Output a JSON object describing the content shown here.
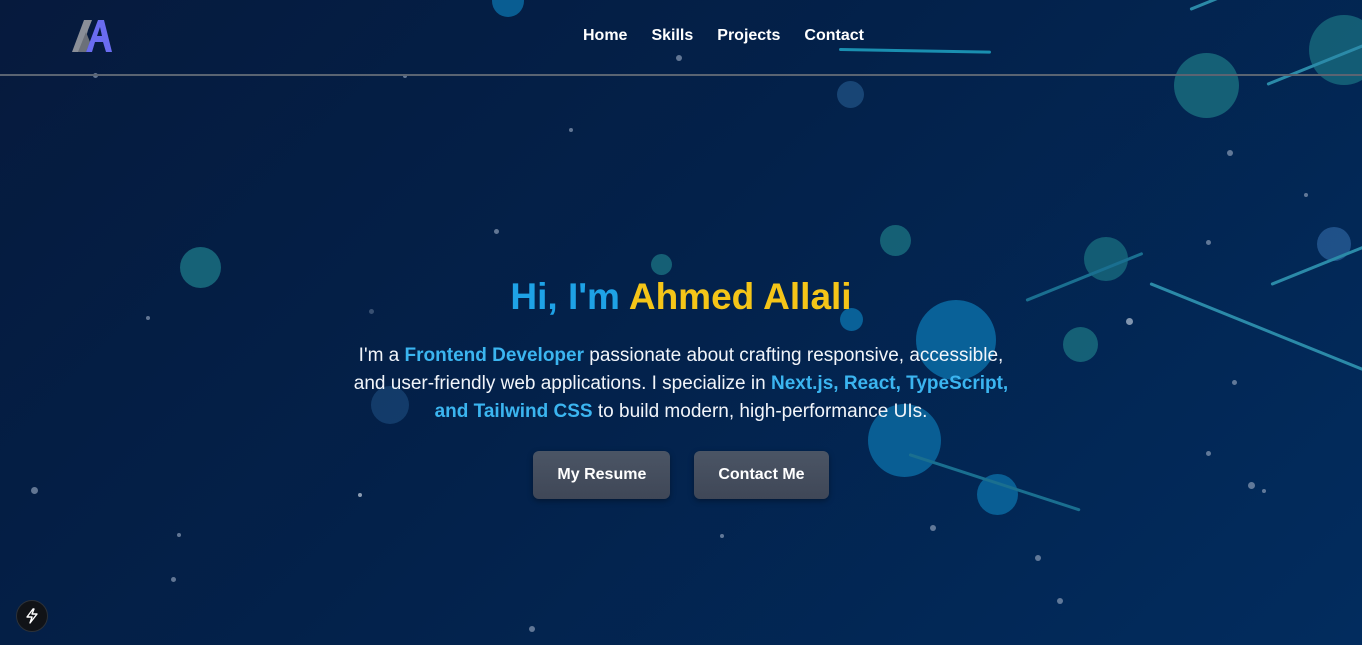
{
  "header": {
    "logo_text": "AA",
    "nav": [
      {
        "label": "Home"
      },
      {
        "label": "Skills"
      },
      {
        "label": "Projects"
      },
      {
        "label": "Contact"
      }
    ]
  },
  "hero": {
    "greeting": "Hi, I'm",
    "name": "Ahmed Allali",
    "desc": {
      "p1": "I'm a ",
      "h1": "Frontend Developer",
      "p2": " passionate about crafting responsive, accessible, and user-friendly web applications. I specialize in ",
      "h2": "Next.js, React, TypeScript, and Tailwind CSS",
      "p3": " to build modern, high-performance UIs."
    },
    "buttons": {
      "resume": "My Resume",
      "contact": "Contact Me"
    }
  },
  "icons": {
    "corner_badge": "lightning-bolt-icon"
  },
  "colors": {
    "greeting": "#1ea2e6",
    "name": "#f5c518",
    "highlight": "#3bb5f0",
    "button_bg": "#4b5565"
  }
}
